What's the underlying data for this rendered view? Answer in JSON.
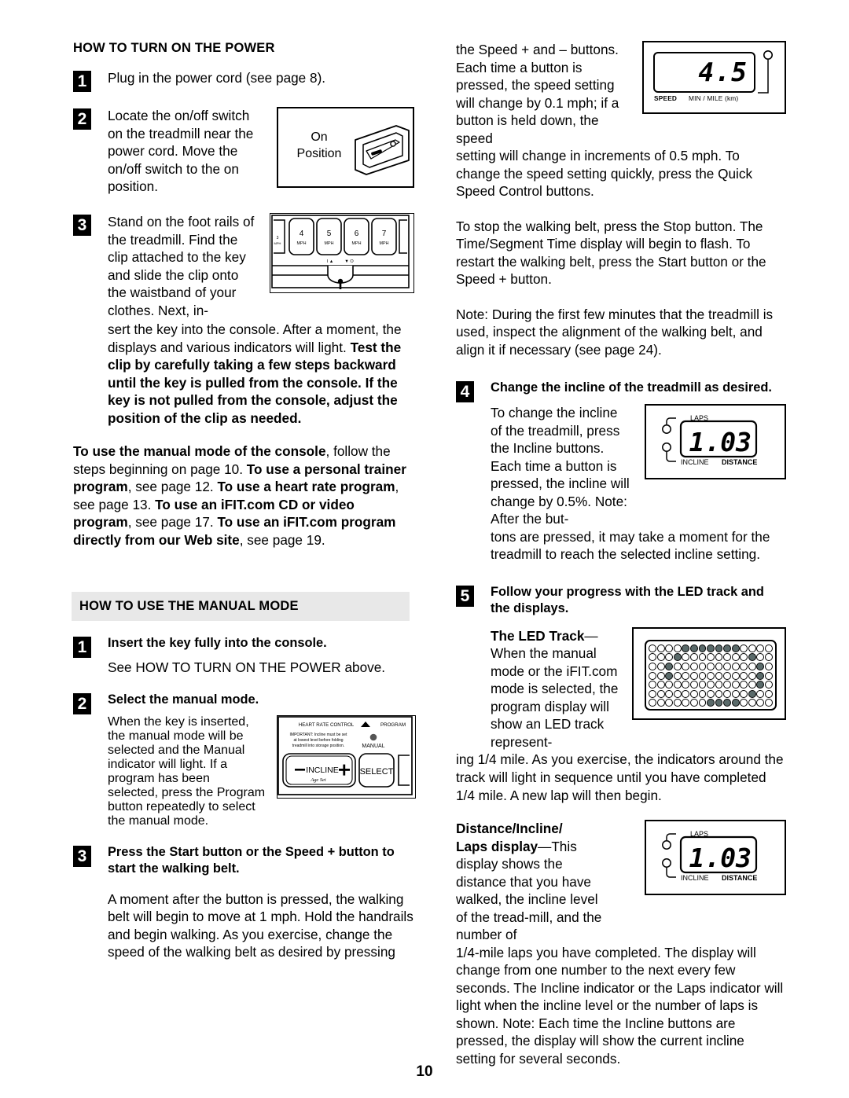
{
  "page": {
    "number": "10"
  },
  "left": {
    "section1_title": "HOW TO TURN ON THE POWER",
    "step1": {
      "num": "1",
      "text": "Plug in the power cord (see page 8)."
    },
    "step2": {
      "num": "2",
      "text": "Locate the on/off switch on the treadmill near the power cord. Move the on/off switch to the on position.",
      "figure": {
        "label_line1": "On",
        "label_line2": "Position",
        "name": "on-position-switch"
      }
    },
    "step3": {
      "num": "3",
      "text_plain_1": "Stand on the foot rails of the treadmill. Find the clip attached to the key and slide the clip onto the waistband of your clothes. Next, insert the key into the console. After a moment, the displays and various indicators will light. ",
      "text_bold_1": "Test the clip by carefully taking a few steps backward until the key is pulled from the console. If the key is not pulled from the console, adjust the position of the clip as needed.",
      "figure": {
        "name": "speed-buttons-console",
        "buttons": [
          {
            "value": "4",
            "unit": "MPH"
          },
          {
            "value": "5",
            "unit": "MPH"
          },
          {
            "value": "6",
            "unit": "MPH"
          },
          {
            "value": "7",
            "unit": "MPH"
          }
        ],
        "key_label": "I▲  ▼O"
      }
    },
    "modes_paragraph": {
      "b1": "To use the manual mode of the console",
      "t1": ", follow the steps beginning on page 10. ",
      "b2": "To use a personal trainer program",
      "t2": ", see page 12. ",
      "b3": "To use a heart rate program",
      "t3": ", see page 13. ",
      "b4": "To use an iFIT.com CD or video program",
      "t4": ", see page 17. ",
      "b5": "To use an iFIT.com program directly from our Web site",
      "t5": ", see page 19."
    },
    "section2_title": "HOW TO USE THE MANUAL MODE",
    "m_step1": {
      "num": "1",
      "heading": "Insert the key fully into the console.",
      "body": "See HOW TO TURN ON THE POWER above."
    },
    "m_step2": {
      "num": "2",
      "heading": "Select the manual mode.",
      "body": "When the key is inserted, the manual mode will be selected and the Manual indicator will light. If a program has been selected, press the Program button repeatedly to select the manual mode.",
      "figure": {
        "name": "manual-mode-console",
        "top_label": "HEART RATE CONTROL",
        "program_label": "PROGRAM",
        "warning": "IMPORTANT: Incline must be set at lowest level before folding treadmill into storage position.",
        "manual_label": "MANUAL",
        "incline_label": "INCLINE",
        "age_set_label": "Age Set",
        "select_label": "SELECT"
      }
    },
    "m_step3": {
      "num": "3",
      "heading": "Press the Start button or the Speed + button to start the walking belt.",
      "body": "A moment after the button is pressed, the walking belt will begin to move at 1 mph. Hold the handrails and begin walking. As you exercise, change the speed of the walking belt as desired by pressing"
    }
  },
  "right": {
    "para1_part1": "the Speed + and – buttons. Each time a button is pressed, the speed setting will change by 0.1 mph; if a button is held down, the speed ",
    "para1_part2": "setting will change in increments of 0.5 mph. To change the speed setting quickly, press the Quick Speed Control buttons.",
    "speed_figure": {
      "name": "speed-display",
      "value": "4.5",
      "label_left": "SPEED",
      "label_right": "MIN / MILE (km)"
    },
    "para2": "To stop the walking belt, press the Stop button. The Time/Segment Time display will begin to flash. To restart the walking belt, press the Start button or the Speed + button.",
    "para3": "Note: During the first few minutes that the treadmill is used, inspect the alignment of the walking belt, and align it if necessary (see page 24).",
    "step4": {
      "num": "4",
      "heading": "Change the incline of the treadmill as desired.",
      "body_part1": "To change the incline of the treadmill, press the Incline buttons. Each time a button is pressed, the incline will change by 0.5%. Note: After the but-",
      "body_part2": "tons are pressed, it may take a moment for the treadmill to reach the selected incline setting.",
      "figure": {
        "name": "incline-laps-display",
        "value": "1.03",
        "label_laps": "LAPS",
        "label_incline": "INCLINE",
        "label_distance": "DISTANCE"
      }
    },
    "step5": {
      "num": "5",
      "heading": "Follow your progress with the LED track and the displays.",
      "led_track_bold": "The LED Track",
      "led_track_dash": "—",
      "led_track_part1": "When the manual mode or the iFIT.com mode is selected, the program display will show an LED track represent-",
      "led_track_part2": "ing 1/4 mile. As you exercise, the indicators around the track will light in sequence until you have completed 1/4 mile. A new lap will then begin.",
      "distance_bold_1": "Distance/Incline/",
      "distance_bold_2": "Laps display",
      "distance_dash": "—",
      "distance_part1": "This display shows the distance that you have walked, the incline level of the tread-mill, and the number of",
      "distance_part2": "1/4-mile laps you have completed. The display will change from one number to the next every few seconds. The Incline indicator or the Laps indicator will light when the incline level or the number of laps is shown. Note: Each time the Incline buttons are pressed, the display will show the current incline setting for several seconds.",
      "led_figure": {
        "name": "led-track-display",
        "rows": 7,
        "cols": 15,
        "lit": [
          [
            4,
            5,
            6,
            7,
            8,
            9,
            10
          ],
          [
            3,
            12
          ],
          [
            2,
            13
          ],
          [
            2,
            13
          ],
          [
            13
          ],
          [
            12
          ],
          [
            7,
            8,
            9,
            10
          ]
        ]
      },
      "distance_figure": {
        "name": "distance-incline-laps-display",
        "value": "1.03",
        "label_laps": "LAPS",
        "label_incline": "INCLINE",
        "label_distance": "DISTANCE"
      }
    }
  }
}
